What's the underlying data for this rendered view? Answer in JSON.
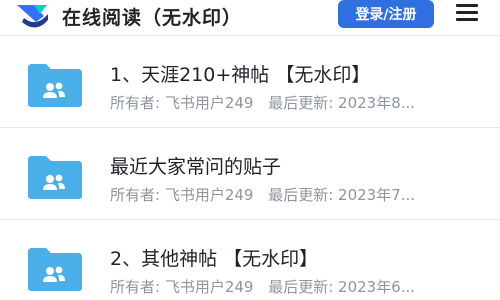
{
  "header": {
    "title": "在线阅读（无水印）",
    "login_label": "登录/注册"
  },
  "icons": {
    "logo": "feishu-logo",
    "menu": "hamburger-menu-icon",
    "folder": "shared-folder-icon"
  },
  "colors": {
    "accent": "#2f6fe0",
    "folder": "#4aaee8",
    "meta_text": "#8f959e"
  },
  "items": [
    {
      "title": "1、天涯210+神帖 【无水印】",
      "owner": "所有者:  飞书用户249",
      "updated": "最后更新:  2023年8..."
    },
    {
      "title": "最近大家常问的贴子",
      "owner": "所有者:  飞书用户249",
      "updated": "最后更新:  2023年7..."
    },
    {
      "title": "2、其他神帖 【无水印】",
      "owner": "所有者:  飞书用户249",
      "updated": "最后更新:  2023年6..."
    }
  ]
}
